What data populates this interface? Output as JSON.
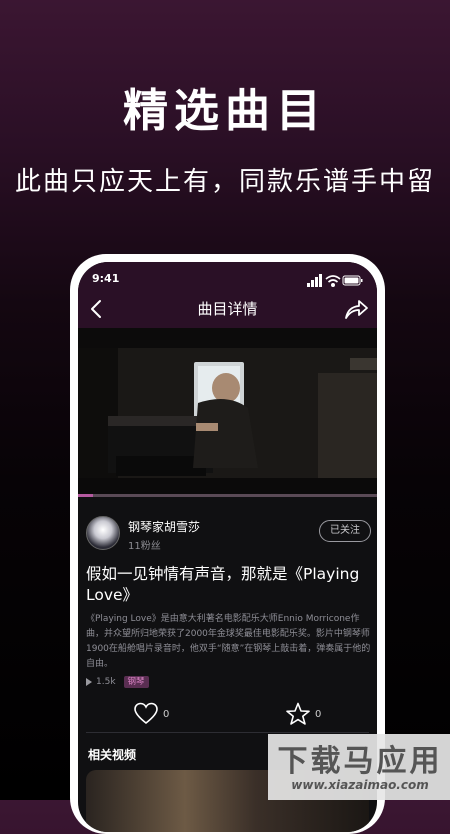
{
  "promo": {
    "headline": "精选曲目",
    "subline": "此曲只应天上有，同款乐谱手中留"
  },
  "status_bar": {
    "time": "9:41"
  },
  "nav": {
    "title": "曲目详情",
    "back_icon": "chevron-left-icon",
    "share_icon": "share-icon"
  },
  "video": {
    "progress_fraction": 0.05
  },
  "author": {
    "name": "钢琴家胡雪莎",
    "fans": "11粉丝",
    "follow_label": "已关注"
  },
  "piece": {
    "title": "假如一见钟情有声音，那就是《Playing Love》",
    "description": "《Playing Love》是由意大利著名电影配乐大师Ennio Morricone作曲，并众望所归地荣获了2000年金球奖最佳电影配乐奖。影片中钢琴师1900在船舱唱片录音时，他双手“随意”在钢琴上敲击着，弹奏属于他的自由。",
    "plays": "1.5k",
    "tag": "钢琴"
  },
  "actions": {
    "like_count": "0",
    "favorite_count": "0"
  },
  "related": {
    "title": "相关视频"
  },
  "watermark": {
    "main": "下载马应用",
    "sub": "www.xiazaimao.com"
  },
  "colors": {
    "accent": "#b55aa0",
    "topbar": "#2a1026",
    "screen_bg": "#101012"
  }
}
